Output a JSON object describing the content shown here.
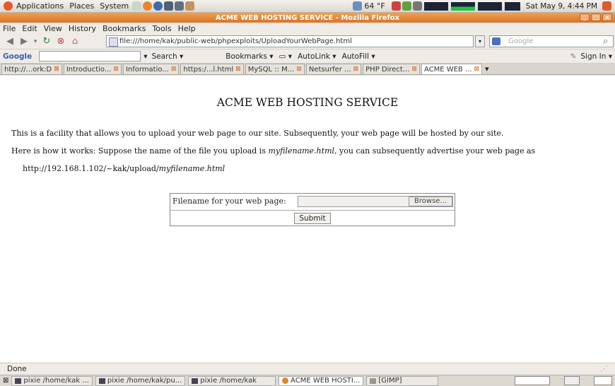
{
  "gnome_panel": {
    "menus": [
      "Applications",
      "Places",
      "System"
    ],
    "weather": "64 °F",
    "clock": "Sat May  9,  4:44 PM"
  },
  "window": {
    "title": "ACME WEB HOSTING SERVICE - Mozilla Firefox"
  },
  "menubar": [
    "File",
    "Edit",
    "View",
    "History",
    "Bookmarks",
    "Tools",
    "Help"
  ],
  "navbar": {
    "url": "file:///home/kak/public-web/phpexploits/UploadYourWebPage.html",
    "search_placeholder": "Google"
  },
  "google_toolbar": {
    "logo": "Google",
    "items": [
      "Search ▾",
      "Bookmarks ▾",
      "▭ ▾",
      "AutoLink ▾",
      "AutoFill ▾",
      "Sign In ▾"
    ]
  },
  "tabs": [
    {
      "label": "http://...ork:D"
    },
    {
      "label": "Introductio..."
    },
    {
      "label": "Informatio..."
    },
    {
      "label": "https:/...l.html"
    },
    {
      "label": "MySQL :: M..."
    },
    {
      "label": "Netsurfer ..."
    },
    {
      "label": "PHP Direct..."
    },
    {
      "label": "ACME WEB ..."
    }
  ],
  "page": {
    "heading": "ACME WEB HOSTING SERVICE",
    "intro": "This is a facility that allows you to upload your web page to our site. Subsequently, your web page will be hosted by our site.",
    "howto_prefix": "Here is how it works: Suppose the name of the file you upload is ",
    "howto_filename": "myfilename.html",
    "howto_suffix": ", you can subsequently advertise your web page as",
    "url_prefix": "http://192.168.1.102/~kak/upload/",
    "url_filename": "myfilename.html",
    "form": {
      "label": "Filename for your web page:",
      "browse": "Browse...",
      "submit": "Submit"
    }
  },
  "status": "Done",
  "taskbar": [
    {
      "label": "pixie /home/kak ..."
    },
    {
      "label": "pixie /home/kak/pu..."
    },
    {
      "label": "pixie /home/kak"
    },
    {
      "label": "ACME WEB HOSTI..."
    },
    {
      "label": "[GIMP]"
    }
  ]
}
